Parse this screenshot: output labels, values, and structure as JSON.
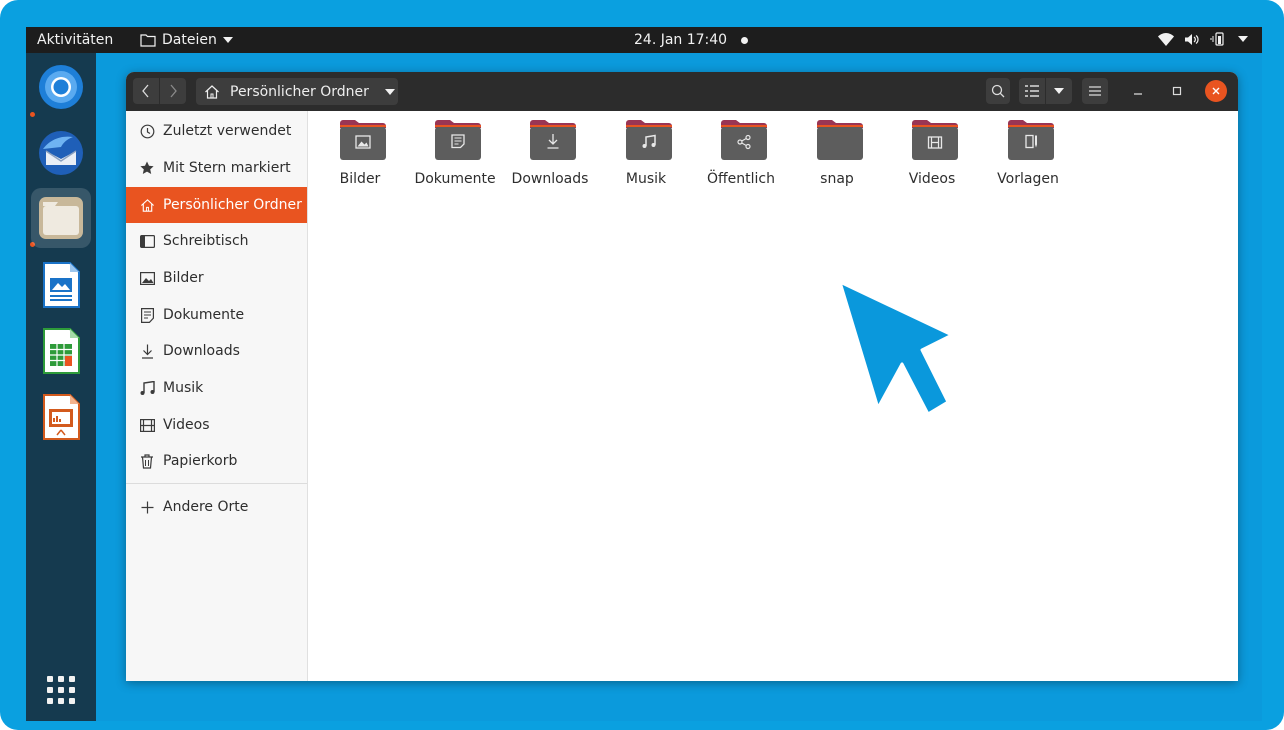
{
  "topbar": {
    "activities": "Aktivitäten",
    "app_menu": "Dateien",
    "clock": "24. Jan  17:40"
  },
  "dock": {
    "apps": [
      "chromium-icon",
      "thunderbird-icon",
      "files-icon",
      "writer-icon",
      "calc-icon",
      "impress-icon"
    ],
    "running": [
      "chromium-icon",
      "files-icon"
    ],
    "active": "files-icon"
  },
  "window": {
    "location": "Persönlicher Ordner"
  },
  "sidebar": {
    "items": [
      {
        "label": "Zuletzt verwendet",
        "icon": "clock-icon"
      },
      {
        "label": "Mit Stern markiert",
        "icon": "star-icon"
      },
      {
        "label": "Persönlicher Ordner",
        "icon": "home-icon",
        "selected": true
      },
      {
        "label": "Schreibtisch",
        "icon": "desktop-icon"
      },
      {
        "label": "Bilder",
        "icon": "image-icon"
      },
      {
        "label": "Dokumente",
        "icon": "document-icon"
      },
      {
        "label": "Downloads",
        "icon": "download-icon"
      },
      {
        "label": "Musik",
        "icon": "music-icon"
      },
      {
        "label": "Videos",
        "icon": "film-icon"
      },
      {
        "label": "Papierkorb",
        "icon": "trash-icon"
      }
    ],
    "other": {
      "label": "Andere Orte",
      "icon": "plus-icon"
    }
  },
  "folders": [
    {
      "label": "Bilder",
      "icon": "image-icon"
    },
    {
      "label": "Dokumente",
      "icon": "document-icon"
    },
    {
      "label": "Downloads",
      "icon": "download-icon"
    },
    {
      "label": "Musik",
      "icon": "music-icon"
    },
    {
      "label": "Öffentlich",
      "icon": "share-icon"
    },
    {
      "label": "snap",
      "icon": "folder-icon"
    },
    {
      "label": "Videos",
      "icon": "film-icon"
    },
    {
      "label": "Vorlagen",
      "icon": "template-icon"
    }
  ],
  "colors": {
    "accent": "#e95420",
    "desktop": "#0b9adc",
    "cursor": "#0a98dc"
  }
}
